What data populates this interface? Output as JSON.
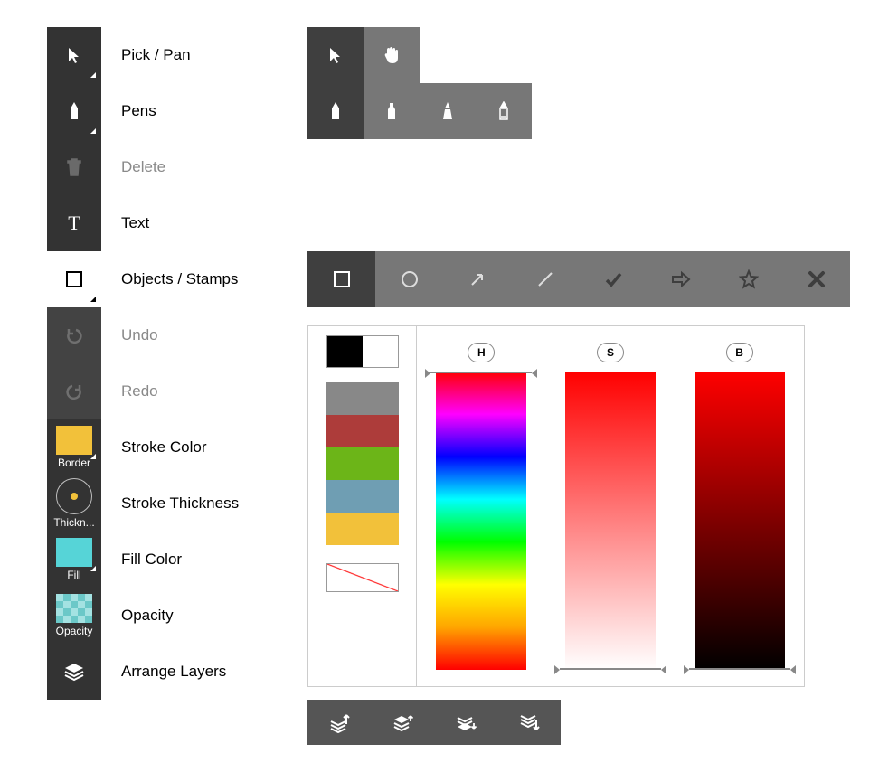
{
  "toolbar": {
    "items": [
      {
        "id": "pick",
        "label": "Pick / Pan",
        "state": "enabled",
        "submark": true
      },
      {
        "id": "pens",
        "label": "Pens",
        "state": "enabled",
        "submark": true
      },
      {
        "id": "delete",
        "label": "Delete",
        "state": "disabled",
        "submark": false
      },
      {
        "id": "text",
        "label": "Text",
        "state": "enabled",
        "submark": false
      },
      {
        "id": "objects",
        "label": "Objects / Stamps",
        "state": "selected",
        "submark": true
      },
      {
        "id": "undo",
        "label": "Undo",
        "state": "disabled",
        "submark": false
      },
      {
        "id": "redo",
        "label": "Redo",
        "state": "disabled",
        "submark": false
      },
      {
        "id": "border",
        "label": "Stroke Color",
        "caption": "Border",
        "swatch": "#f2c13a",
        "submark": true
      },
      {
        "id": "thickness",
        "label": "Stroke Thickness",
        "caption": "Thickn...",
        "kind": "thickness"
      },
      {
        "id": "fill",
        "label": "Fill Color",
        "caption": "Fill",
        "swatch": "#56d4d7",
        "submark": true
      },
      {
        "id": "opacity",
        "label": "Opacity",
        "caption": "Opacity",
        "kind": "checker"
      },
      {
        "id": "arrange",
        "label": "Arrange Layers",
        "state": "enabled"
      }
    ]
  },
  "pickpan": {
    "items": [
      "pointer",
      "hand"
    ]
  },
  "pens": {
    "items": [
      "pen",
      "marker",
      "brush",
      "pencil"
    ]
  },
  "shapes": {
    "items": [
      "square",
      "circle",
      "arrow-ne",
      "line",
      "check",
      "arrow-right",
      "star",
      "x-mark"
    ]
  },
  "arrange": {
    "items": [
      "to-front",
      "forward",
      "backward",
      "to-back"
    ]
  },
  "hsb": {
    "h": "H",
    "s": "S",
    "b": "B"
  },
  "palette": {
    "current_fg": "#000000",
    "current_bg": "#ffffff",
    "swatches": [
      "#888888",
      "#ad3c3a",
      "#6cb518",
      "#6f9eb3",
      "#f2c13a"
    ]
  }
}
